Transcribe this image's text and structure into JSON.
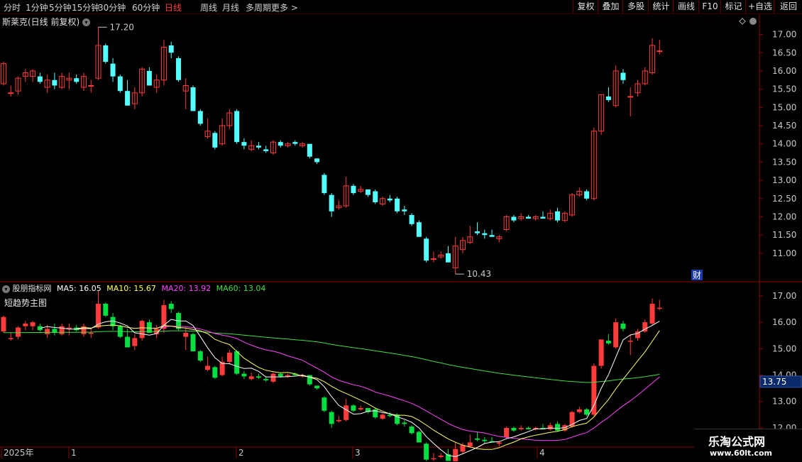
{
  "toolbar": {
    "periods": [
      "分时",
      "1分钟",
      "5分钟",
      "15分钟",
      "30分钟",
      "60分钟",
      "日线",
      "周线",
      "月线",
      "多周期",
      "更多 >"
    ],
    "active_period": "日线",
    "right_buttons": [
      "复权",
      "叠加",
      "多股",
      "统计",
      "画线",
      "F10",
      "标记",
      "+自选",
      "返回"
    ]
  },
  "main_panel": {
    "title": "斯莱克(日线 前复权)",
    "high_label": "17.20",
    "low_label": "10.43",
    "finance_badge": "财",
    "y_ticks": [
      "17.00",
      "16.50",
      "16.00",
      "15.50",
      "15.00",
      "14.50",
      "14.00",
      "13.50",
      "13.00",
      "12.50",
      "12.00",
      "11.50",
      "11.00"
    ]
  },
  "sub_panel": {
    "source_label": "股朋指标网",
    "ma5_label": "MA5: 16.05",
    "ma10_label": "MA10: 15.67",
    "ma20_label": "MA20: 13.92",
    "ma60_label": "MA60: 13.04",
    "indicator_name": "短趋势主图",
    "current_value_label": "13.75",
    "y_ticks": [
      "17.00",
      "16.00",
      "15.00",
      "14.00",
      "13.00",
      "12.00"
    ]
  },
  "x_axis": {
    "labels": [
      "2025年",
      "1",
      "2",
      "3",
      "4"
    ]
  },
  "watermark": {
    "cn": "乐淘公式网",
    "url": "www.60lt.com"
  },
  "colors": {
    "up": "#ff3b3b",
    "down_main": "#54ffff",
    "down_sub": "#00e040",
    "ma5": "#ffffff",
    "ma10": "#ffff66",
    "ma20": "#ff44ff",
    "ma60": "#44dd44",
    "grid": "#8b0000",
    "bg": "#000000"
  },
  "chart_data": {
    "type": "candlestick",
    "title": "斯莱克(日线 前复权)",
    "ylim_main": [
      10.2,
      17.4
    ],
    "ylim_sub": [
      11.3,
      17.4
    ],
    "x_month_labels": [
      "2025年",
      "1",
      "2",
      "3",
      "4"
    ],
    "candles": [
      {
        "o": 15.65,
        "h": 16.25,
        "l": 15.6,
        "c": 16.2
      },
      {
        "o": 15.4,
        "h": 15.6,
        "l": 15.3,
        "c": 15.4
      },
      {
        "o": 15.45,
        "h": 15.85,
        "l": 15.35,
        "c": 15.8
      },
      {
        "o": 15.85,
        "h": 16.05,
        "l": 15.7,
        "c": 15.95
      },
      {
        "o": 15.85,
        "h": 16.05,
        "l": 15.7,
        "c": 16.0
      },
      {
        "o": 15.85,
        "h": 15.95,
        "l": 15.65,
        "c": 15.7
      },
      {
        "o": 15.55,
        "h": 15.9,
        "l": 15.4,
        "c": 15.75
      },
      {
        "o": 15.75,
        "h": 15.95,
        "l": 15.5,
        "c": 15.6
      },
      {
        "o": 15.55,
        "h": 15.95,
        "l": 15.5,
        "c": 15.85
      },
      {
        "o": 15.75,
        "h": 15.95,
        "l": 15.5,
        "c": 15.8
      },
      {
        "o": 15.8,
        "h": 15.9,
        "l": 15.65,
        "c": 15.7
      },
      {
        "o": 15.55,
        "h": 15.95,
        "l": 15.45,
        "c": 15.85
      },
      {
        "o": 15.6,
        "h": 15.75,
        "l": 15.4,
        "c": 15.6
      },
      {
        "o": 15.8,
        "h": 17.2,
        "l": 15.75,
        "c": 16.7
      },
      {
        "o": 16.7,
        "h": 16.75,
        "l": 16.2,
        "c": 16.25
      },
      {
        "o": 16.2,
        "h": 16.35,
        "l": 15.7,
        "c": 15.85
      },
      {
        "o": 15.85,
        "h": 15.9,
        "l": 15.4,
        "c": 15.45
      },
      {
        "o": 15.45,
        "h": 15.75,
        "l": 15.05,
        "c": 15.05
      },
      {
        "o": 15.1,
        "h": 15.55,
        "l": 14.95,
        "c": 15.4
      },
      {
        "o": 15.4,
        "h": 16.1,
        "l": 15.3,
        "c": 16.05
      },
      {
        "o": 16.0,
        "h": 16.1,
        "l": 15.6,
        "c": 15.6
      },
      {
        "o": 15.55,
        "h": 15.9,
        "l": 15.4,
        "c": 15.75
      },
      {
        "o": 15.75,
        "h": 16.85,
        "l": 15.6,
        "c": 16.65
      },
      {
        "o": 16.7,
        "h": 16.8,
        "l": 16.35,
        "c": 16.5
      },
      {
        "o": 16.35,
        "h": 16.4,
        "l": 15.7,
        "c": 15.75
      },
      {
        "o": 15.45,
        "h": 15.8,
        "l": 14.95,
        "c": 15.6
      },
      {
        "o": 15.55,
        "h": 15.6,
        "l": 14.9,
        "c": 14.9
      },
      {
        "o": 14.9,
        "h": 14.95,
        "l": 14.5,
        "c": 14.55
      },
      {
        "o": 14.2,
        "h": 14.7,
        "l": 14.15,
        "c": 14.35
      },
      {
        "o": 14.3,
        "h": 14.35,
        "l": 13.85,
        "c": 13.9
      },
      {
        "o": 14.0,
        "h": 14.7,
        "l": 13.95,
        "c": 14.5
      },
      {
        "o": 14.5,
        "h": 14.95,
        "l": 14.4,
        "c": 14.85
      },
      {
        "o": 14.9,
        "h": 14.95,
        "l": 14.0,
        "c": 14.05
      },
      {
        "o": 14.05,
        "h": 14.15,
        "l": 13.85,
        "c": 13.95
      },
      {
        "o": 13.85,
        "h": 14.1,
        "l": 13.8,
        "c": 13.95
      },
      {
        "o": 13.95,
        "h": 14.05,
        "l": 13.85,
        "c": 13.9
      },
      {
        "o": 13.85,
        "h": 13.95,
        "l": 13.75,
        "c": 13.8
      },
      {
        "o": 13.75,
        "h": 14.1,
        "l": 13.7,
        "c": 14.05
      },
      {
        "o": 14.05,
        "h": 14.1,
        "l": 13.9,
        "c": 13.95
      },
      {
        "o": 13.95,
        "h": 14.05,
        "l": 13.9,
        "c": 14.0
      },
      {
        "o": 14.05,
        "h": 14.1,
        "l": 13.95,
        "c": 14.0
      },
      {
        "o": 13.95,
        "h": 14.05,
        "l": 13.9,
        "c": 14.0
      },
      {
        "o": 14.0,
        "h": 14.0,
        "l": 13.6,
        "c": 13.65
      },
      {
        "o": 13.6,
        "h": 13.6,
        "l": 13.45,
        "c": 13.5
      },
      {
        "o": 13.15,
        "h": 13.2,
        "l": 12.6,
        "c": 12.65
      },
      {
        "o": 12.6,
        "h": 12.65,
        "l": 12.0,
        "c": 12.15
      },
      {
        "o": 12.25,
        "h": 12.45,
        "l": 12.2,
        "c": 12.3
      },
      {
        "o": 12.3,
        "h": 13.1,
        "l": 12.25,
        "c": 12.85
      },
      {
        "o": 12.85,
        "h": 12.9,
        "l": 12.6,
        "c": 12.65
      },
      {
        "o": 12.7,
        "h": 12.85,
        "l": 12.65,
        "c": 12.75
      },
      {
        "o": 12.75,
        "h": 12.75,
        "l": 12.55,
        "c": 12.6
      },
      {
        "o": 12.7,
        "h": 12.75,
        "l": 12.35,
        "c": 12.4
      },
      {
        "o": 12.35,
        "h": 12.55,
        "l": 12.3,
        "c": 12.5
      },
      {
        "o": 12.5,
        "h": 12.6,
        "l": 12.4,
        "c": 12.45
      },
      {
        "o": 12.5,
        "h": 12.55,
        "l": 12.1,
        "c": 12.15
      },
      {
        "o": 12.2,
        "h": 12.3,
        "l": 12.05,
        "c": 12.15
      },
      {
        "o": 12.05,
        "h": 12.1,
        "l": 11.75,
        "c": 11.8
      },
      {
        "o": 11.85,
        "h": 11.9,
        "l": 11.45,
        "c": 11.45
      },
      {
        "o": 11.4,
        "h": 11.45,
        "l": 10.75,
        "c": 10.8
      },
      {
        "o": 10.85,
        "h": 11.05,
        "l": 10.75,
        "c": 10.85
      },
      {
        "o": 10.9,
        "h": 11.05,
        "l": 10.85,
        "c": 10.95
      },
      {
        "o": 11.0,
        "h": 11.2,
        "l": 10.85,
        "c": 10.75
      },
      {
        "o": 10.6,
        "h": 11.45,
        "l": 10.43,
        "c": 11.2
      },
      {
        "o": 11.1,
        "h": 11.45,
        "l": 11.0,
        "c": 11.35
      },
      {
        "o": 11.3,
        "h": 11.75,
        "l": 11.25,
        "c": 11.45
      },
      {
        "o": 11.6,
        "h": 11.85,
        "l": 11.5,
        "c": 11.55
      },
      {
        "o": 11.55,
        "h": 11.65,
        "l": 11.4,
        "c": 11.5
      },
      {
        "o": 11.5,
        "h": 11.65,
        "l": 11.45,
        "c": 11.45
      },
      {
        "o": 11.4,
        "h": 11.5,
        "l": 11.3,
        "c": 11.45
      },
      {
        "o": 11.65,
        "h": 12.05,
        "l": 11.6,
        "c": 12.0
      },
      {
        "o": 12.0,
        "h": 12.05,
        "l": 11.85,
        "c": 11.9
      },
      {
        "o": 11.95,
        "h": 12.1,
        "l": 11.9,
        "c": 12.0
      },
      {
        "o": 12.0,
        "h": 12.05,
        "l": 11.95,
        "c": 11.95
      },
      {
        "o": 11.95,
        "h": 12.05,
        "l": 11.9,
        "c": 12.0
      },
      {
        "o": 12.0,
        "h": 12.15,
        "l": 11.95,
        "c": 11.95
      },
      {
        "o": 11.95,
        "h": 12.2,
        "l": 11.9,
        "c": 12.1
      },
      {
        "o": 12.15,
        "h": 12.25,
        "l": 11.85,
        "c": 11.9
      },
      {
        "o": 11.9,
        "h": 12.15,
        "l": 11.85,
        "c": 12.1
      },
      {
        "o": 12.05,
        "h": 12.65,
        "l": 12.0,
        "c": 12.6
      },
      {
        "o": 12.6,
        "h": 12.8,
        "l": 12.55,
        "c": 12.7
      },
      {
        "o": 12.7,
        "h": 12.75,
        "l": 12.45,
        "c": 12.5
      },
      {
        "o": 12.5,
        "h": 14.45,
        "l": 12.45,
        "c": 14.35
      },
      {
        "o": 14.35,
        "h": 15.35,
        "l": 14.25,
        "c": 15.35
      },
      {
        "o": 15.3,
        "h": 15.55,
        "l": 15.15,
        "c": 15.2
      },
      {
        "o": 15.05,
        "h": 16.15,
        "l": 15.0,
        "c": 16.0
      },
      {
        "o": 15.95,
        "h": 16.05,
        "l": 15.65,
        "c": 15.75
      },
      {
        "o": 15.3,
        "h": 15.55,
        "l": 14.75,
        "c": 15.3
      },
      {
        "o": 15.4,
        "h": 15.75,
        "l": 15.3,
        "c": 15.65
      },
      {
        "o": 15.65,
        "h": 16.1,
        "l": 15.6,
        "c": 16.0
      },
      {
        "o": 15.95,
        "h": 16.9,
        "l": 15.9,
        "c": 16.7
      },
      {
        "o": 16.55,
        "h": 16.85,
        "l": 16.45,
        "c": 16.55
      }
    ]
  }
}
